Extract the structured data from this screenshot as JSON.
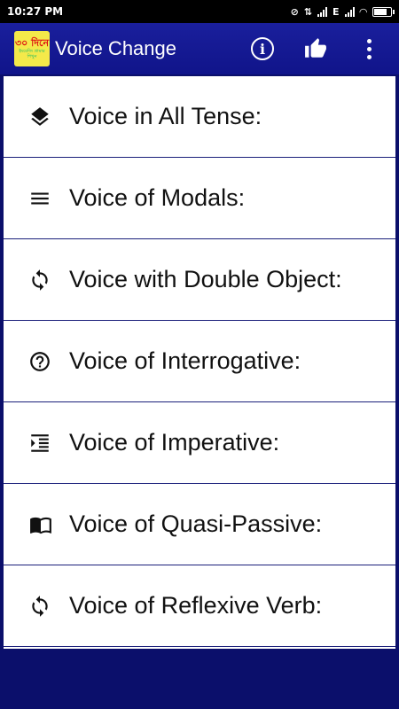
{
  "status_bar": {
    "time": "10:27 PM",
    "network": "E",
    "battery_level": 0.85
  },
  "app_bar": {
    "title": "Voice Change",
    "logo_text_top": "৩০ দিনে",
    "logo_text_bottom": "ইংরেজি গ্রামার শিখুন",
    "actions": [
      "info-icon",
      "thumbs-up-icon",
      "overflow-menu-icon"
    ]
  },
  "menu": {
    "items": [
      {
        "label": "Voice in All Tense:",
        "icon": "layers-icon"
      },
      {
        "label": "Voice of Modals:",
        "icon": "menu-lines-icon"
      },
      {
        "label": "Voice with Double Object:",
        "icon": "sync-icon"
      },
      {
        "label": "Voice of Interrogative:",
        "icon": "help-circle-icon"
      },
      {
        "label": "Voice of Imperative:",
        "icon": "indent-icon"
      },
      {
        "label": "Voice of Quasi-Passive:",
        "icon": "book-icon"
      },
      {
        "label": "Voice of Reflexive Verb:",
        "icon": "sync-icon"
      }
    ]
  },
  "colors": {
    "app_bar": "#1a1f9c",
    "background": "#0b0f6b",
    "divider": "#1a1f7a",
    "list_bg": "#ffffff"
  }
}
